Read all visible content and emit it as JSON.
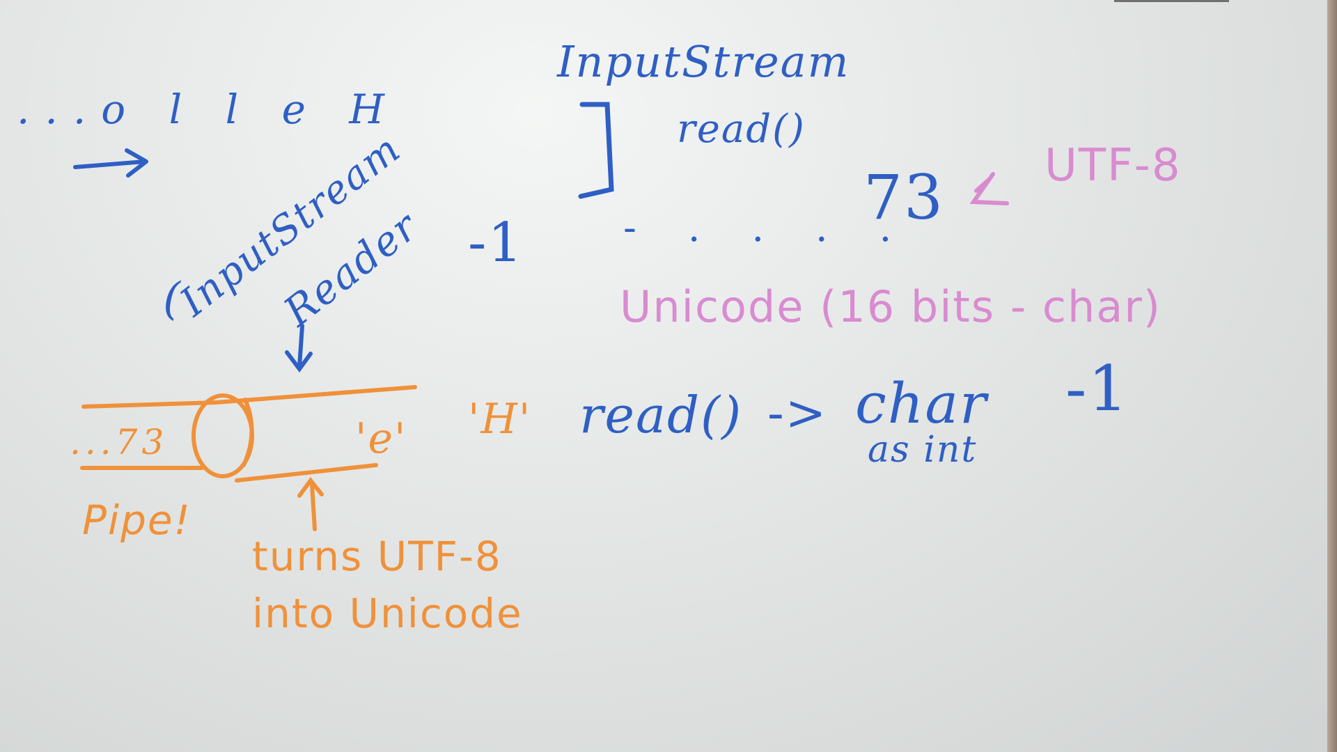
{
  "colors": {
    "blue_marker": "#2f5fc4",
    "pink_marker": "#d98bd0",
    "orange_marker": "#f0913a",
    "board": "#e6e9e8"
  },
  "top_left": {
    "letters": "...o l l e H"
  },
  "inputstream": {
    "title": "InputStream",
    "method": "read()"
  },
  "value_73": "73",
  "utf8_label": "UTF-8",
  "minus_one_mid": "-1",
  "ellipsis": "- . . . .",
  "unicode_note": "Unicode (16 bits - char)",
  "reader": {
    "line1": "InputStream",
    "line2": "Reader",
    "open_paren": "("
  },
  "pipe": {
    "bytes": "...73",
    "char_e": "'e'",
    "char_H": "'H'",
    "label": "Pipe!",
    "note_line1": "turns UTF-8",
    "note_line2": "into Unicode"
  },
  "read_line": {
    "call": "read()",
    "arrow": "->",
    "returns": "char",
    "as_int": "as int",
    "end": "-1"
  }
}
